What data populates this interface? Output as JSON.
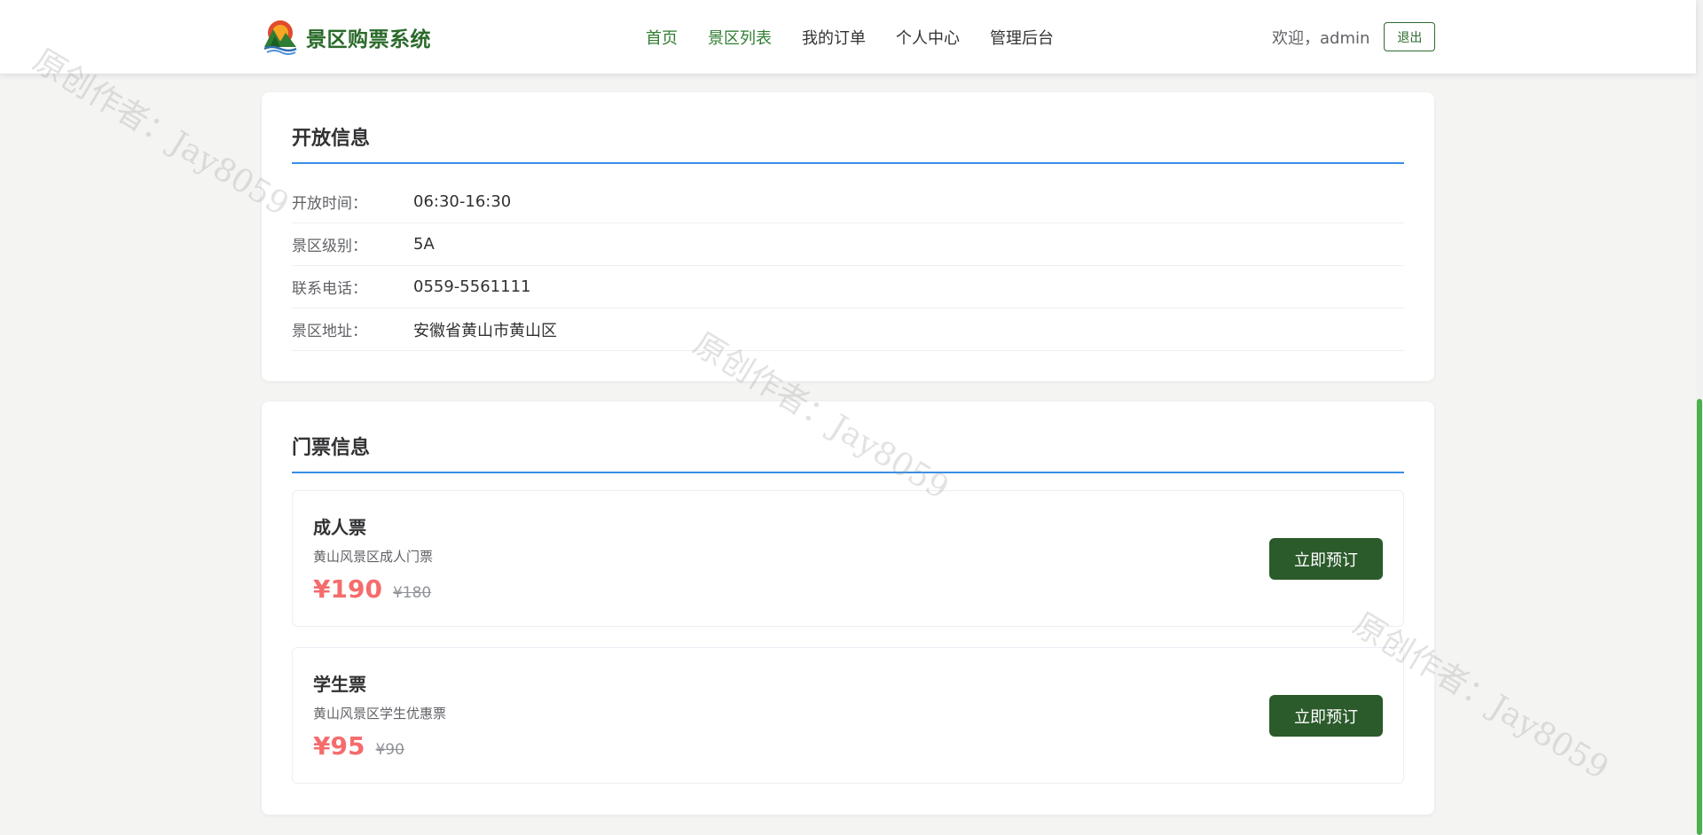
{
  "header": {
    "logo_text": "景区购票系统",
    "nav": [
      {
        "label": "首页"
      },
      {
        "label": "景区列表"
      },
      {
        "label": "我的订单"
      },
      {
        "label": "个人中心"
      },
      {
        "label": "管理后台"
      }
    ],
    "welcome": "欢迎，admin",
    "logout_label": "退出"
  },
  "open_info": {
    "title": "开放信息",
    "rows": [
      {
        "label": "开放时间：",
        "value": "06:30-16:30"
      },
      {
        "label": "景区级别：",
        "value": "5A"
      },
      {
        "label": "联系电话：",
        "value": "0559-5561111"
      },
      {
        "label": "景区地址：",
        "value": "安徽省黄山市黄山区"
      }
    ]
  },
  "ticket_info": {
    "title": "门票信息",
    "tickets": [
      {
        "name": "成人票",
        "desc": "黄山风景区成人门票",
        "price": "¥190",
        "original_price": "¥180",
        "button": "立即预订"
      },
      {
        "name": "学生票",
        "desc": "黄山风景区学生优惠票",
        "price": "¥95",
        "original_price": "¥90",
        "button": "立即预订"
      }
    ]
  },
  "watermark": "原创作者：Jay8059",
  "colors": {
    "brand_green": "#2a6a2a",
    "nav_active": "#2f7d32",
    "button_green": "#2b5a2b",
    "title_underline": "#3a8ee6",
    "price_red": "#f56c6c",
    "scrollbar": "#4caf50"
  }
}
